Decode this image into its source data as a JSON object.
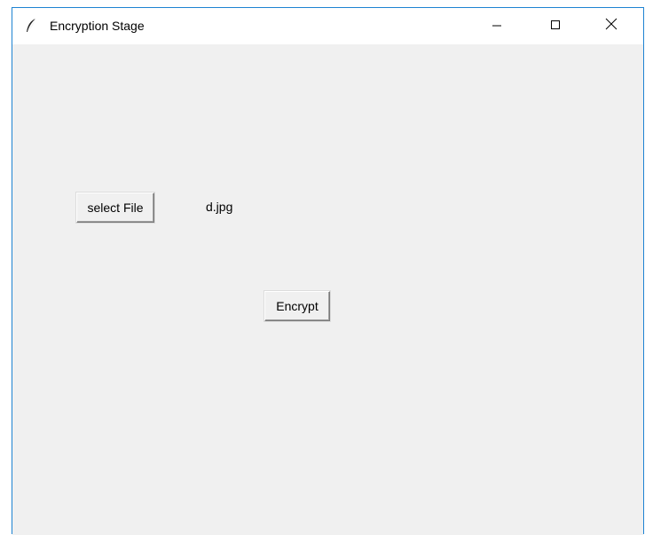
{
  "window": {
    "title": "Encryption Stage",
    "icon": "tk-feather-icon",
    "controls": {
      "minimize": "minimize-icon",
      "maximize": "maximize-icon",
      "close": "close-icon"
    },
    "accent_color": "#1e83d2",
    "background_color": "#f0f0f0"
  },
  "main": {
    "select_button_label": "select File",
    "selected_file": "d.jpg",
    "encrypt_button_label": "Encrypt"
  }
}
